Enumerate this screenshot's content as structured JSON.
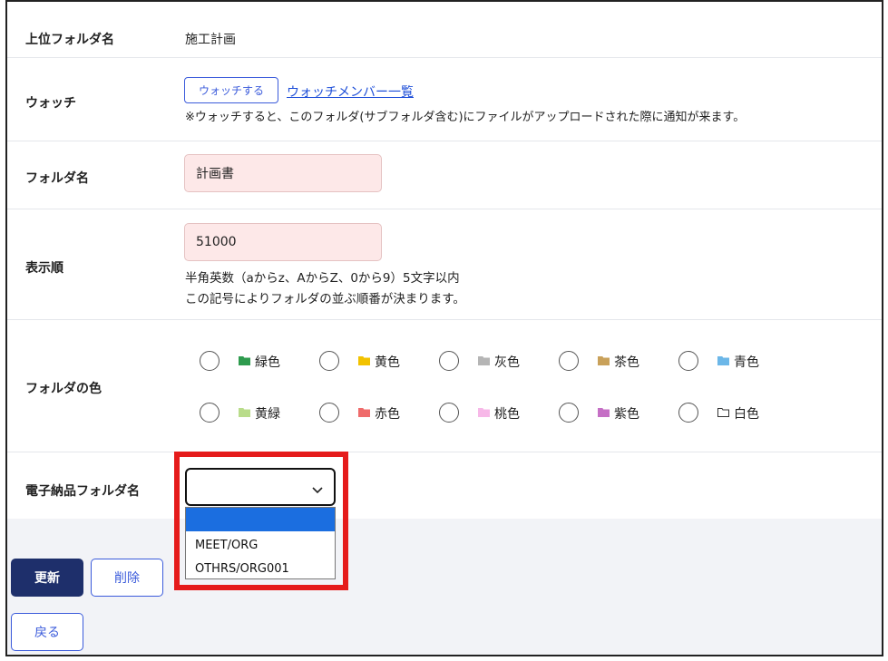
{
  "form": {
    "parent_folder": {
      "label": "上位フォルダ名",
      "value": "施工計画"
    },
    "watch": {
      "label": "ウォッチ",
      "watch_button": "ウォッチする",
      "members_link": "ウォッチメンバー一覧",
      "note": "※ウォッチすると、このフォルダ(サブフォルダ含む)にファイルがアップロードされた際に通知が来ます。"
    },
    "folder_name": {
      "label": "フォルダ名",
      "value": "計画書"
    },
    "display_order": {
      "label": "表示順",
      "value": "51000",
      "note1": "半角英数（aからz、AからZ、0から9）5文字以内",
      "note2": "この記号によりフォルダの並ぶ順番が決まります。"
    },
    "folder_color": {
      "label": "フォルダの色",
      "options": [
        {
          "label": "緑色",
          "color": "#2e9b4e"
        },
        {
          "label": "黄色",
          "color": "#f2c200"
        },
        {
          "label": "灰色",
          "color": "#b5b5b5"
        },
        {
          "label": "茶色",
          "color": "#c9a15a"
        },
        {
          "label": "青色",
          "color": "#6cb7e8"
        },
        {
          "label": "黄緑",
          "color": "#b9dc8a"
        },
        {
          "label": "赤色",
          "color": "#ef6b6b"
        },
        {
          "label": "桃色",
          "color": "#f7b8e8"
        },
        {
          "label": "紫色",
          "color": "#c56fc5"
        },
        {
          "label": "白色",
          "color": "#ffffff"
        }
      ]
    },
    "edelivery_folder": {
      "label": "電子納品フォルダ名",
      "selected": "",
      "options": [
        "",
        "MEET/ORG",
        "OTHRS/ORG001"
      ]
    }
  },
  "actions": {
    "update": "更新",
    "delete": "削除",
    "back": "戻る"
  }
}
